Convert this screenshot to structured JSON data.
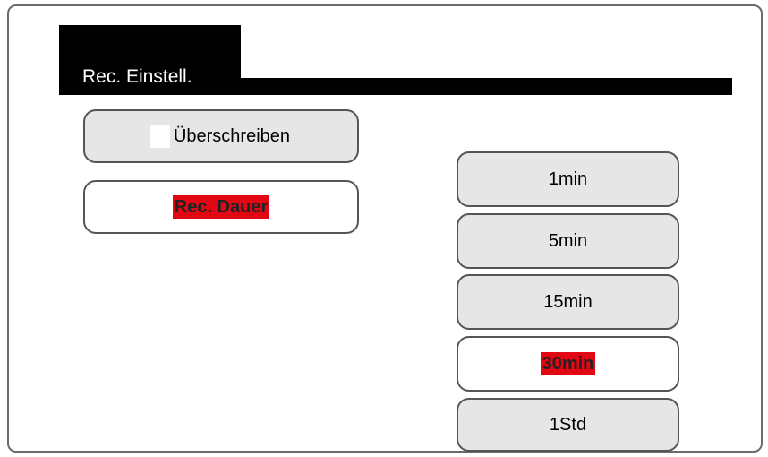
{
  "header": {
    "title": "Rec. Einstell."
  },
  "menu": {
    "overwrite_label": "Überschreiben",
    "rec_duration_label": "Rec. Dauer"
  },
  "durations": {
    "opt_1min": "1min",
    "opt_5min": "5min",
    "opt_15min": "15min",
    "opt_30min": "30min",
    "opt_1std": "1Std",
    "selected": "30min"
  },
  "colors": {
    "highlight": "#e30613",
    "button_bg": "#e6e6e6",
    "header_bg": "#000000"
  }
}
